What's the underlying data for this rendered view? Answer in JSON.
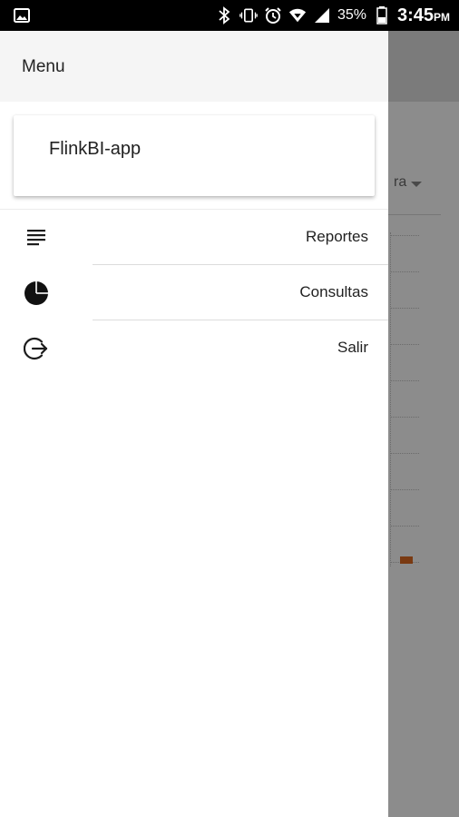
{
  "status_bar": {
    "icons": [
      "image-icon",
      "bluetooth-icon",
      "vibrate-icon",
      "alarm-icon",
      "wifi-icon",
      "signal-icon",
      "battery-icon"
    ],
    "battery": "35%",
    "time": "3:45",
    "ampm": "PM"
  },
  "background_app": {
    "dropdown_text": "ra"
  },
  "drawer": {
    "title": "Menu",
    "app_name": "FlinkBI-app",
    "items": [
      {
        "label": "Reportes",
        "icon": "list-icon"
      },
      {
        "label": "Consultas",
        "icon": "pie-chart-icon"
      },
      {
        "label": "Salir",
        "icon": "logout-icon"
      }
    ]
  },
  "colors": {
    "drawer_bg": "#ffffff",
    "header_bg": "#f5f5f5",
    "scrim": "#8c8c8c",
    "accent_bar": "#7a3a12"
  }
}
